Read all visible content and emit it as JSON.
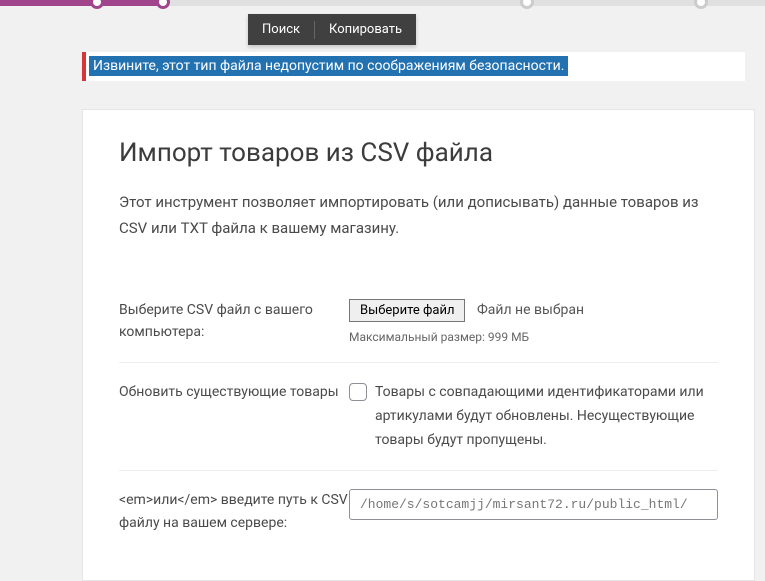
{
  "tooltip": {
    "search": "Поиск",
    "copy": "Копировать"
  },
  "error": {
    "message": "Извините, этот тип файла недопустим по соображениям безопасности."
  },
  "page": {
    "title": "Импорт товаров из CSV файла",
    "description": "Этот инструмент позволяет импортировать (или дописывать) данные товаров из CSV или TXT файла к вашему магазину."
  },
  "form": {
    "file_field": {
      "label": "Выберите CSV файл с вашего компьютера:",
      "button": "Выберите файл",
      "status": "Файл не выбран",
      "hint": "Максимальный размер: 999 МБ"
    },
    "update_field": {
      "label": "Обновить существующие товары",
      "description": "Товары с совпадающими идентификаторами или артикулами будут обновлены. Несуществующие товары будут пропущены."
    },
    "path_field": {
      "label": "<em>или</em> введите путь к CSV файлу на вашем сервере:",
      "value": "/home/s/sotcamjj/mirsant72.ru/public_html/"
    }
  }
}
